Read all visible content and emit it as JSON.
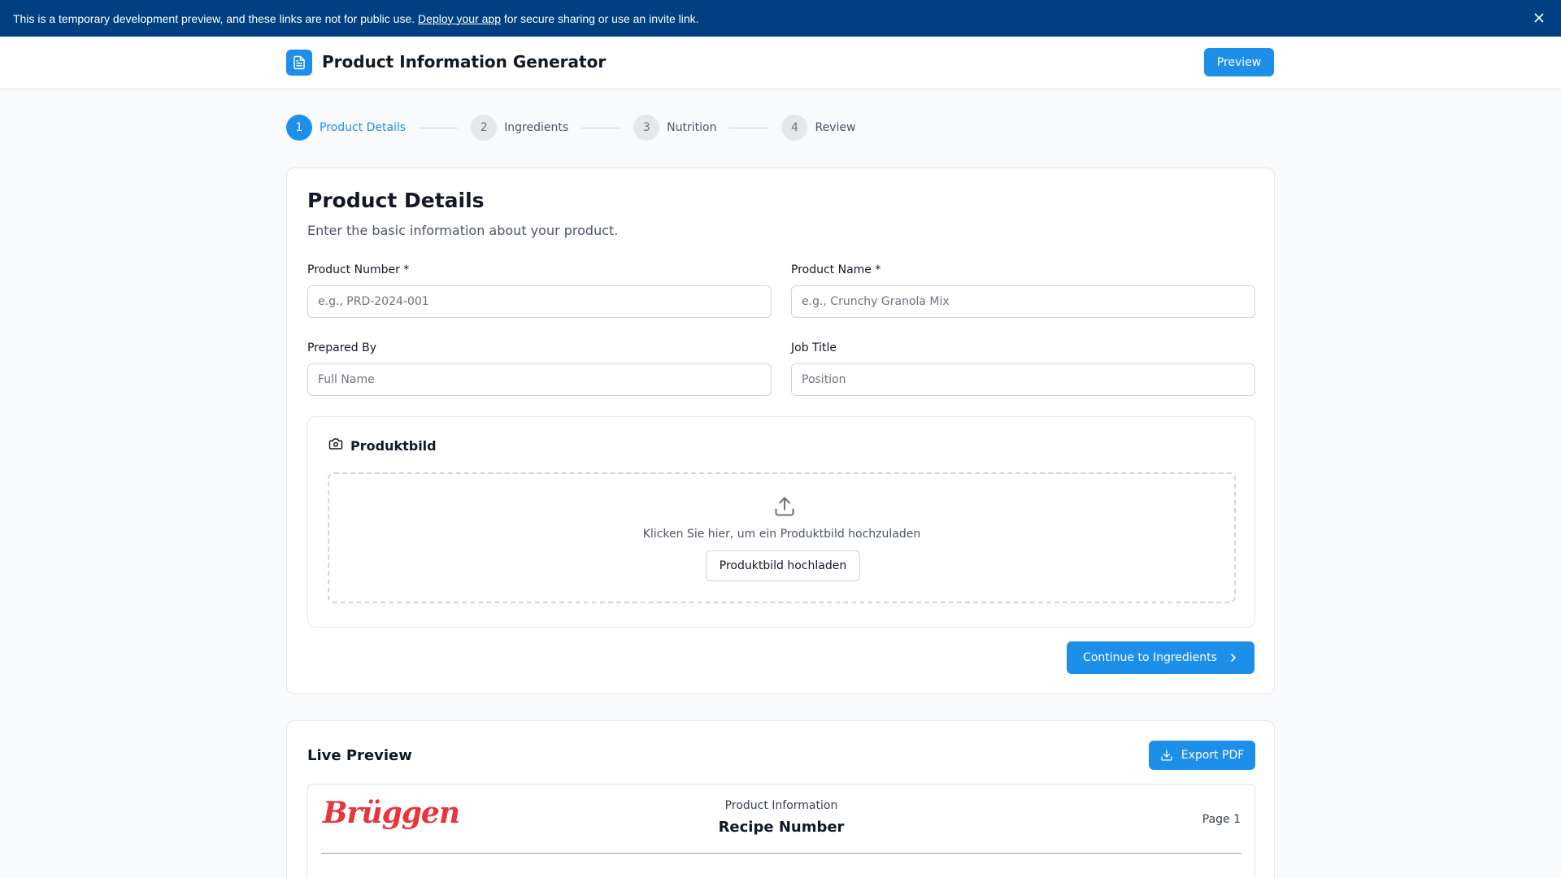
{
  "banner": {
    "text_before": "This is a temporary development preview, and these links are not for public use.",
    "link": "Deploy your app",
    "text_after": "for secure sharing or use an invite link.",
    "close_icon": "close-icon"
  },
  "header": {
    "title": "Product Information Generator",
    "logo_icon": "document-icon",
    "preview_label": "Preview"
  },
  "stepper": [
    {
      "number": "1",
      "label": "Product Details",
      "active": true
    },
    {
      "number": "2",
      "label": "Ingredients",
      "active": false
    },
    {
      "number": "3",
      "label": "Nutrition",
      "active": false
    },
    {
      "number": "4",
      "label": "Review",
      "active": false
    }
  ],
  "form": {
    "title": "Product Details",
    "subtitle": "Enter the basic information about your product.",
    "product_number": {
      "label": "Product Number *",
      "placeholder": "e.g., PRD-2024-001",
      "value": ""
    },
    "product_name": {
      "label": "Product Name *",
      "placeholder": "e.g., Crunchy Granola Mix",
      "value": ""
    },
    "prepared_by": {
      "label": "Prepared By",
      "placeholder": "Full Name",
      "value": ""
    },
    "job_title": {
      "label": "Job Title",
      "placeholder": "Position",
      "value": ""
    },
    "image": {
      "title": "Produktbild",
      "icon": "camera-icon",
      "hint": "Klicken Sie hier, um ein Produktbild hochzuladen",
      "button": "Produktbild hochladen",
      "upload_icon": "upload-icon"
    },
    "continue_label": "Continue to Ingredients"
  },
  "preview": {
    "title": "Live Preview",
    "export_label": "Export PDF",
    "brand": "Brüggen",
    "doc_subtitle": "Product Information",
    "doc_title": "Recipe Number",
    "page": "Page 1"
  },
  "colors": {
    "accent": "#1d8fe8",
    "banner": "#003f80",
    "brand": "#e8343a"
  }
}
